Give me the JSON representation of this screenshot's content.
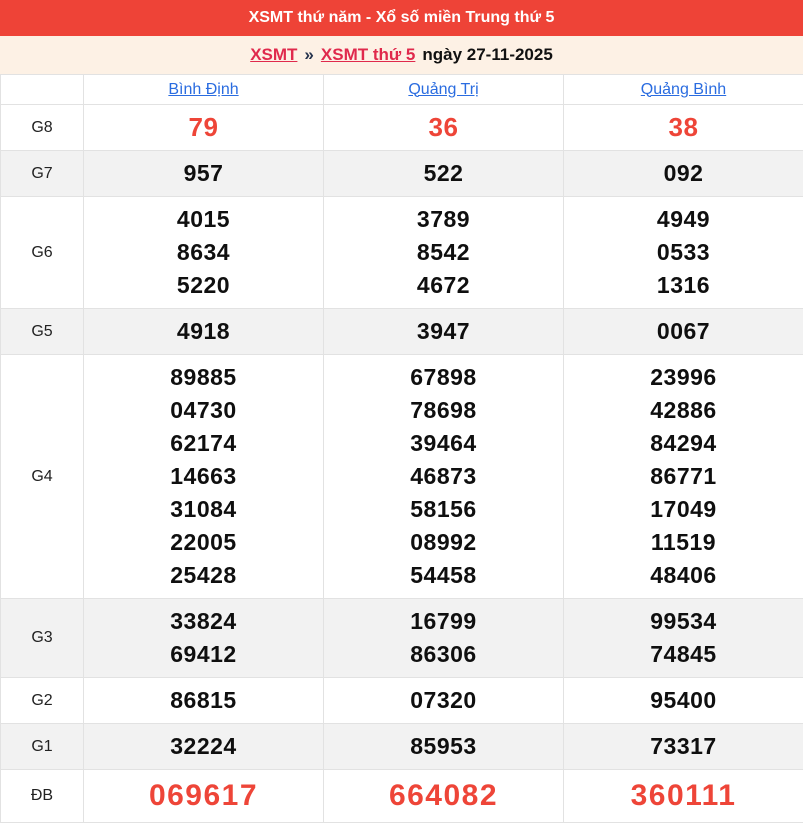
{
  "title_bar": {
    "title": "XSMT thứ năm - Xổ số miền Trung thứ 5"
  },
  "breadcrumb": {
    "link_xsmt": "XSMT",
    "separator": "»",
    "link_day": "XSMT thứ 5",
    "date_text": "ngày 27-11-2025"
  },
  "table": {
    "provinces": [
      "Bình Định",
      "Quảng Trị",
      "Quảng Bình"
    ],
    "rows": [
      {
        "key": "g8",
        "label": "G8",
        "style": "red",
        "cells": [
          [
            "79"
          ],
          [
            "36"
          ],
          [
            "38"
          ]
        ]
      },
      {
        "key": "g7",
        "label": "G7",
        "style": "normal",
        "cells": [
          [
            "957"
          ],
          [
            "522"
          ],
          [
            "092"
          ]
        ]
      },
      {
        "key": "g6",
        "label": "G6",
        "style": "normal",
        "cells": [
          [
            "4015",
            "8634",
            "5220"
          ],
          [
            "3789",
            "8542",
            "4672"
          ],
          [
            "4949",
            "0533",
            "1316"
          ]
        ]
      },
      {
        "key": "g5",
        "label": "G5",
        "style": "normal",
        "cells": [
          [
            "4918"
          ],
          [
            "3947"
          ],
          [
            "0067"
          ]
        ]
      },
      {
        "key": "g4",
        "label": "G4",
        "style": "normal",
        "cells": [
          [
            "89885",
            "04730",
            "62174",
            "14663",
            "31084",
            "22005",
            "25428"
          ],
          [
            "67898",
            "78698",
            "39464",
            "46873",
            "58156",
            "08992",
            "54458"
          ],
          [
            "23996",
            "42886",
            "84294",
            "86771",
            "17049",
            "11519",
            "48406"
          ]
        ]
      },
      {
        "key": "g3",
        "label": "G3",
        "style": "normal",
        "cells": [
          [
            "33824",
            "69412"
          ],
          [
            "16799",
            "86306"
          ],
          [
            "99534",
            "74845"
          ]
        ]
      },
      {
        "key": "g2",
        "label": "G2",
        "style": "normal",
        "cells": [
          [
            "86815"
          ],
          [
            "07320"
          ],
          [
            "95400"
          ]
        ]
      },
      {
        "key": "g1",
        "label": "G1",
        "style": "normal",
        "cells": [
          [
            "32224"
          ],
          [
            "85953"
          ],
          [
            "73317"
          ]
        ]
      },
      {
        "key": "db",
        "label": "ĐB",
        "style": "special",
        "cells": [
          [
            "069617"
          ],
          [
            "664082"
          ],
          [
            "360111"
          ]
        ]
      }
    ]
  },
  "colors": {
    "title_bar_bg": "#ee4337",
    "breadcrumb_bg": "#fdf1e5",
    "breadcrumb_link_red": "#e0294c",
    "province_link_blue": "#2a6ce0",
    "number_red": "#ee4538",
    "number_black": "#0f0f0f",
    "row_alt_bg": "#f2f2f2",
    "table_border": "#e2e2e2"
  }
}
